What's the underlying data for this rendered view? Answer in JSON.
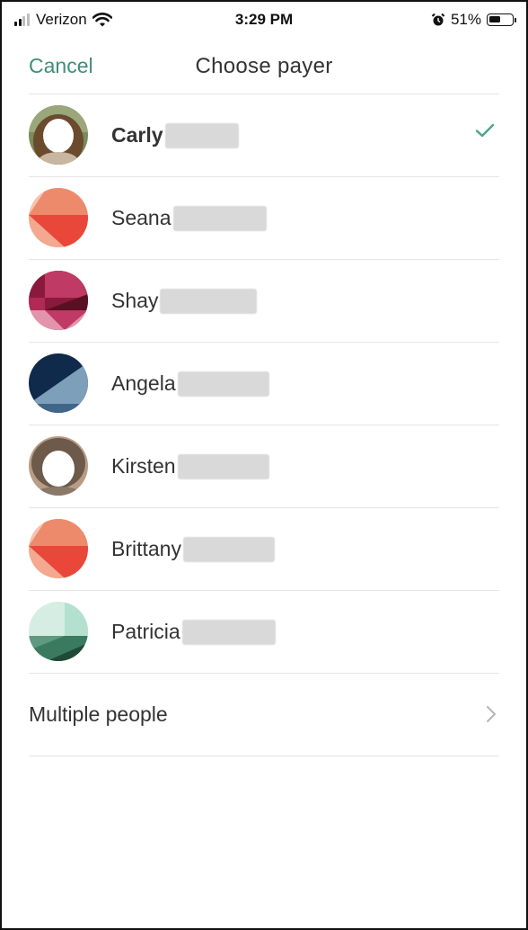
{
  "status_bar": {
    "carrier": "Verizon",
    "time": "3:29 PM",
    "battery_percent": "51%",
    "battery_level": 0.51,
    "icons": [
      "signal-icon",
      "wifi-icon",
      "alarm-icon",
      "battery-icon"
    ]
  },
  "nav": {
    "cancel_label": "Cancel",
    "title": "Choose payer"
  },
  "payers": [
    {
      "first_name": "Carly",
      "selected": true,
      "avatar": "photo"
    },
    {
      "first_name": "Seana",
      "selected": false,
      "avatar": "pattern",
      "colors": [
        "#f6c3b0",
        "#ee8a6c",
        "#e8473a"
      ]
    },
    {
      "first_name": "Shay",
      "selected": false,
      "avatar": "pattern",
      "colors": [
        "#8a1a3c",
        "#c03a66",
        "#5b0f22",
        "#e493ad"
      ]
    },
    {
      "first_name": "Angela",
      "selected": false,
      "avatar": "pattern",
      "colors": [
        "#0f2a4a",
        "#7d9fb9",
        "#3f6688"
      ]
    },
    {
      "first_name": "Kirsten",
      "selected": false,
      "avatar": "photo"
    },
    {
      "first_name": "Brittany",
      "selected": false,
      "avatar": "pattern",
      "colors": [
        "#f6c3b0",
        "#ee8a6c",
        "#e8473a"
      ]
    },
    {
      "first_name": "Patricia",
      "selected": false,
      "avatar": "pattern",
      "colors": [
        "#d6ede4",
        "#b4e0d0",
        "#3a7a5e",
        "#1f4a37"
      ]
    }
  ],
  "multiple": {
    "label": "Multiple people"
  },
  "colors": {
    "accent": "#3f8f78",
    "text": "#333333",
    "divider": "#e6e6e6",
    "redaction": "#d9d9d9"
  }
}
